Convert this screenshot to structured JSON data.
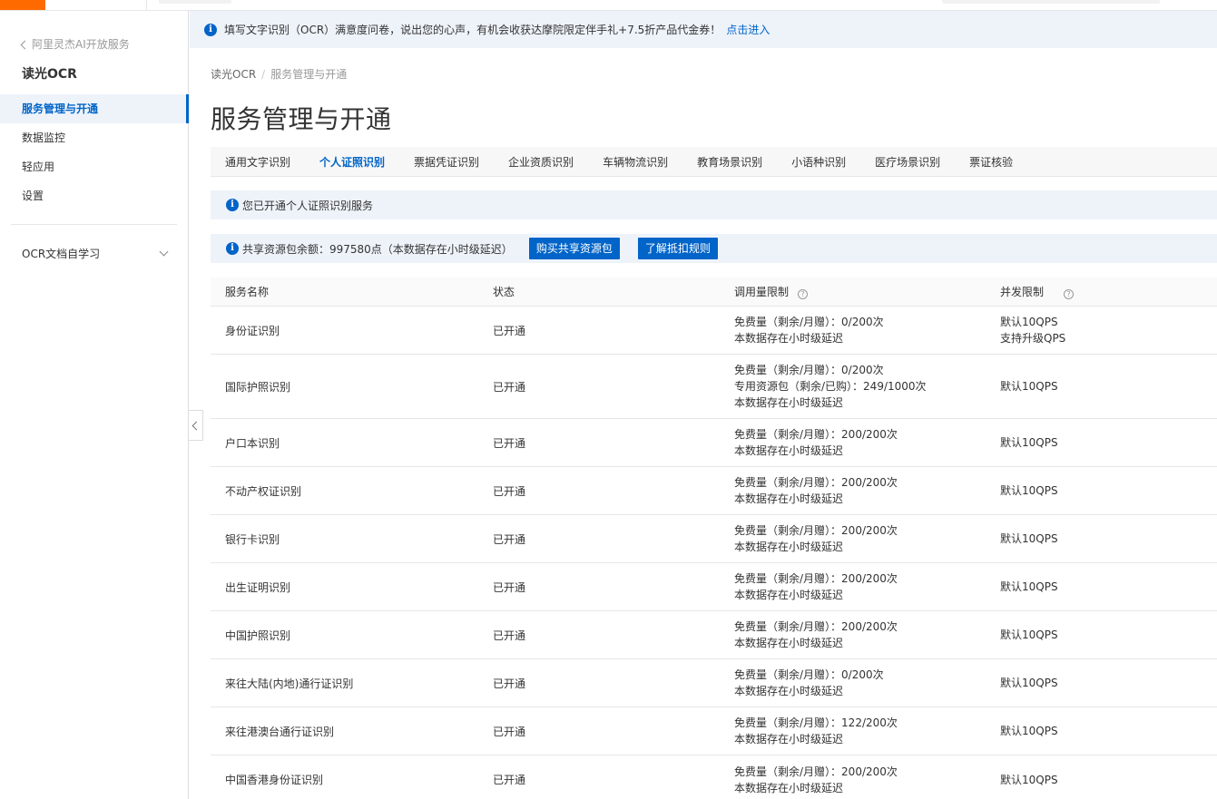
{
  "sidebar": {
    "back_label": "阿里灵杰AI开放服务",
    "title": "读光OCR",
    "items": [
      {
        "label": "服务管理与开通",
        "active": true
      },
      {
        "label": "数据监控"
      },
      {
        "label": "轻应用"
      },
      {
        "label": "设置"
      }
    ],
    "group_label": "OCR文档自学习"
  },
  "notice": {
    "text": "填写文字识别（OCR）满意度问卷，说出您的心声，有机会收获达摩院限定伴手礼+7.5折产品代金券！",
    "link": "点击进入"
  },
  "breadcrumb": [
    "读光OCR",
    "服务管理与开通"
  ],
  "page_title": "服务管理与开通",
  "tabs": [
    "通用文字识别",
    "个人证照识别",
    "票据凭证识别",
    "企业资质识别",
    "车辆物流识别",
    "教育场景识别",
    "小语种识别",
    "医疗场景识别",
    "票证核验"
  ],
  "active_tab": "个人证照识别",
  "alert_text": "您已开通个人证照识别服务",
  "balance": {
    "text": "共享资源包余额：997580点（本数据存在小时级延迟）",
    "buy_button": "购买共享资源包",
    "rules_button": "了解抵扣规则"
  },
  "table": {
    "headers": [
      "服务名称",
      "状态",
      "调用量限制",
      "并发限制"
    ],
    "rows": [
      {
        "name": "身份证识别",
        "status": "已开通",
        "quota": [
          "免费量（剩余/月赠）：0/200次",
          "本数据存在小时级延迟"
        ],
        "qps": [
          "默认10QPS",
          "支持升级QPS"
        ]
      },
      {
        "name": "国际护照识别",
        "status": "已开通",
        "quota": [
          "免费量（剩余/月赠）：0/200次",
          "专用资源包（剩余/已购）：249/1000次",
          "本数据存在小时级延迟"
        ],
        "qps": [
          "默认10QPS"
        ]
      },
      {
        "name": "户口本识别",
        "status": "已开通",
        "quota": [
          "免费量（剩余/月赠）：200/200次",
          "本数据存在小时级延迟"
        ],
        "qps": [
          "默认10QPS"
        ]
      },
      {
        "name": "不动产权证识别",
        "status": "已开通",
        "quota": [
          "免费量（剩余/月赠）：200/200次",
          "本数据存在小时级延迟"
        ],
        "qps": [
          "默认10QPS"
        ]
      },
      {
        "name": "银行卡识别",
        "status": "已开通",
        "quota": [
          "免费量（剩余/月赠）：200/200次",
          "本数据存在小时级延迟"
        ],
        "qps": [
          "默认10QPS"
        ]
      },
      {
        "name": "出生证明识别",
        "status": "已开通",
        "quota": [
          "免费量（剩余/月赠）：200/200次",
          "本数据存在小时级延迟"
        ],
        "qps": [
          "默认10QPS"
        ]
      },
      {
        "name": "中国护照识别",
        "status": "已开通",
        "quota": [
          "免费量（剩余/月赠）：200/200次",
          "本数据存在小时级延迟"
        ],
        "qps": [
          "默认10QPS"
        ]
      },
      {
        "name": "来往大陆(内地)通行证识别",
        "status": "已开通",
        "quota": [
          "免费量（剩余/月赠）：0/200次",
          "本数据存在小时级延迟"
        ],
        "qps": [
          "默认10QPS"
        ]
      },
      {
        "name": "来往港澳台通行证识别",
        "status": "已开通",
        "quota": [
          "免费量（剩余/月赠）：122/200次",
          "本数据存在小时级延迟"
        ],
        "qps": [
          "默认10QPS"
        ]
      },
      {
        "name": "中国香港身份证识别",
        "status": "已开通",
        "quota": [
          "免费量（剩余/月赠）：200/200次",
          "本数据存在小时级延迟"
        ],
        "qps": [
          "默认10QPS"
        ]
      }
    ]
  },
  "colors": {
    "accent": "#0064c8",
    "brand": "#ff6a00",
    "info_bg": "#eef3fa"
  },
  "icons": {
    "info": "info-icon",
    "help": "question-circle-icon",
    "back": "chevron-left-icon",
    "expand": "chevron-down-icon",
    "collapse": "chevron-left-icon"
  }
}
